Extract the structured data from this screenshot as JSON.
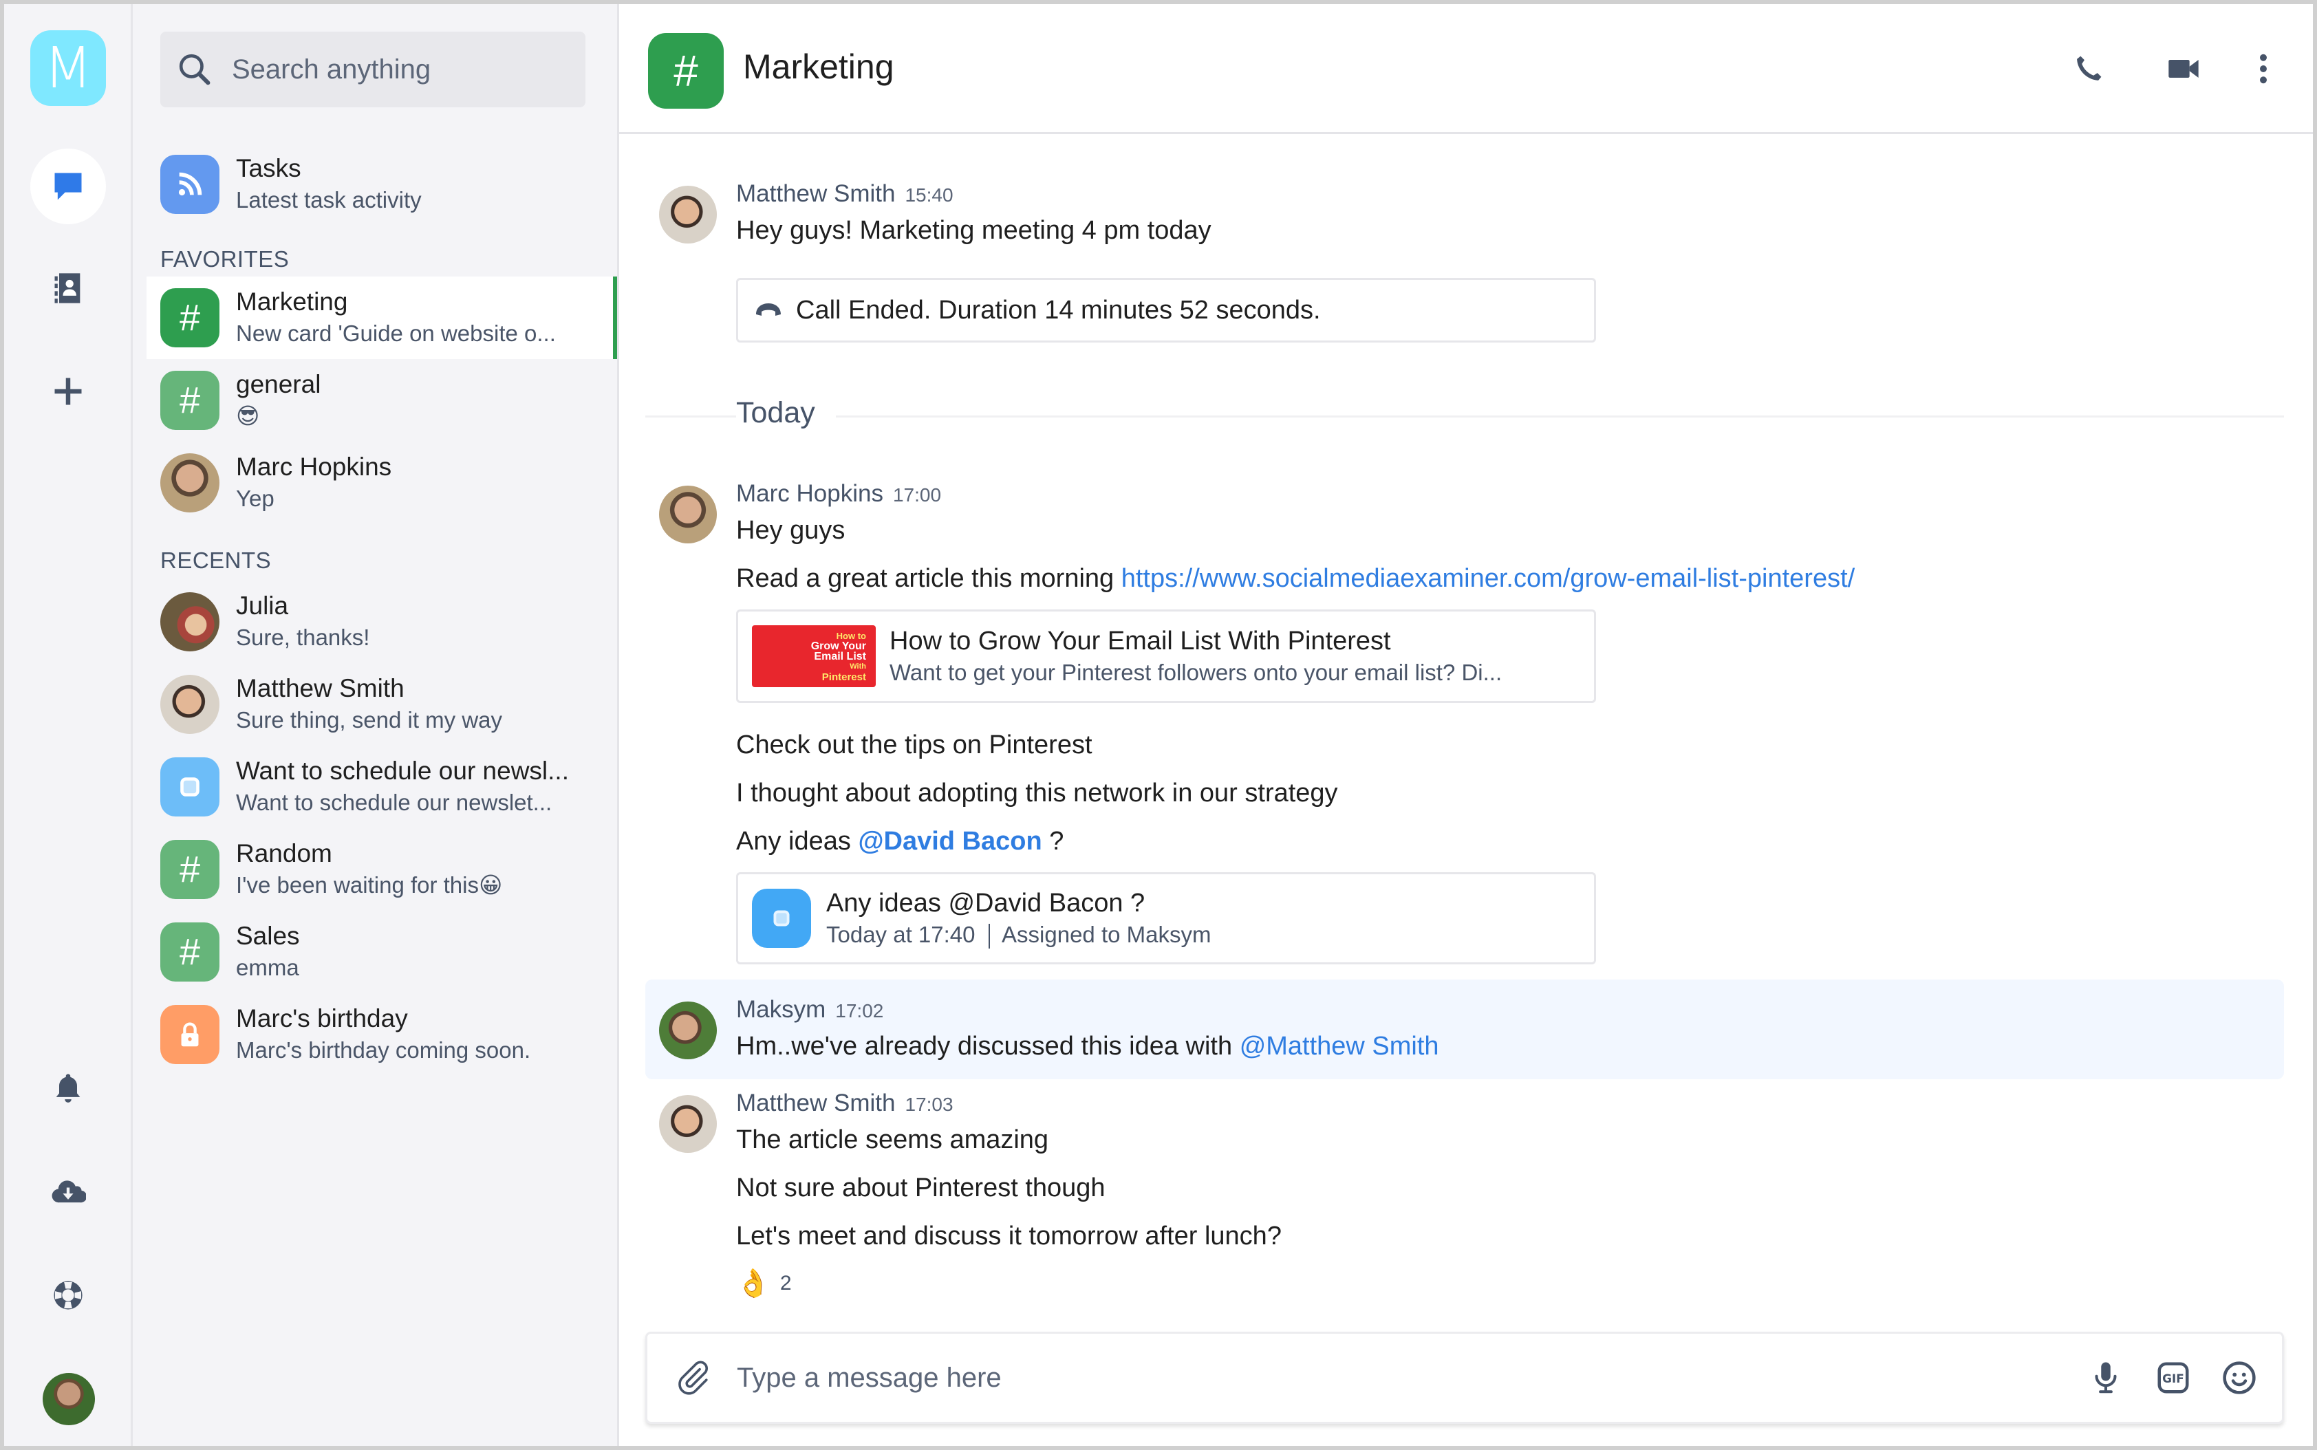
{
  "rail": {
    "logo_letter": "M",
    "items": [
      {
        "name": "chats",
        "icon": "chat-bubble-icon",
        "active": true
      },
      {
        "name": "contacts",
        "icon": "address-book-icon",
        "active": false
      },
      {
        "name": "add",
        "icon": "plus-icon",
        "active": false
      }
    ],
    "bottom_items": [
      {
        "name": "notifications",
        "icon": "bell-icon"
      },
      {
        "name": "download",
        "icon": "cloud-download-icon"
      },
      {
        "name": "help",
        "icon": "lifebuoy-icon"
      },
      {
        "name": "profile",
        "icon": "user-avatar"
      }
    ]
  },
  "sidebar": {
    "search_placeholder": "Search anything",
    "tasks": {
      "title": "Tasks",
      "subtitle": "Latest task activity",
      "icon": "rss-feed-icon"
    },
    "favorites_label": "FAVORITES",
    "favorites": [
      {
        "title": "Marketing",
        "subtitle": "New card 'Guide on website o...",
        "icon": "hash-icon",
        "selected": true
      },
      {
        "title": "general",
        "subtitle": "😎",
        "icon": "hash-icon",
        "selected": false
      },
      {
        "title": "Marc Hopkins",
        "subtitle": "Yep",
        "icon": "avatar",
        "selected": false
      }
    ],
    "recents_label": "RECENTS",
    "recents": [
      {
        "title": "Julia",
        "subtitle": "Sure, thanks!",
        "icon": "avatar"
      },
      {
        "title": "Matthew Smith",
        "subtitle": "Sure thing, send it my way",
        "icon": "avatar"
      },
      {
        "title": "Want to schedule our newsl...",
        "subtitle": "Want to schedule our newslet...",
        "icon": "task-icon"
      },
      {
        "title": "Random",
        "subtitle": "I've been waiting for this😀",
        "icon": "hash-icon"
      },
      {
        "title": "Sales",
        "subtitle": "emma",
        "icon": "hash-icon"
      },
      {
        "title": "Marc's birthday",
        "subtitle": "Marc's birthday coming soon.",
        "icon": "lock-icon"
      }
    ]
  },
  "header": {
    "title": "Marketing",
    "actions": [
      "phone-icon",
      "video-camera-icon",
      "more-vertical-icon"
    ]
  },
  "messages": {
    "m1": {
      "author": "Matthew Smith",
      "time": "15:40",
      "text": "Hey guys! Marketing meeting 4 pm today",
      "call_card": "Call Ended. Duration 14 minutes 52 seconds."
    },
    "divider_label": "Today",
    "m2": {
      "author": "Marc Hopkins",
      "time": "17:00",
      "line1": "Hey guys",
      "line2_prefix": "Read a great article this morning ",
      "line2_link": "https://www.socialmediaexaminer.com/grow-email-list-pinterest/",
      "preview_title": "How to Grow Your Email List With Pinterest",
      "preview_desc": "Want to get your Pinterest followers onto your email list? Di...",
      "preview_thumb_lines": [
        "How to",
        "Grow Your",
        "Email List",
        "With",
        "Pinterest"
      ],
      "line3": "Check out the tips on Pinterest",
      "line4": "I thought about adopting this network in our strategy",
      "line5_prefix": "Any ideas ",
      "line5_mention": "@David Bacon",
      "line5_suffix": " ?",
      "task_title": "Any ideas @David Bacon ?",
      "task_time": "Today at 17:40",
      "task_assigned": "Assigned to  Maksym"
    },
    "m3": {
      "author": "Maksym",
      "time": "17:02",
      "text_prefix": "Hm..we've already discussed this idea with ",
      "mention": "@Matthew Smith"
    },
    "m4": {
      "author": "Matthew Smith",
      "time": "17:03",
      "line1": "The article seems amazing",
      "line2": "Not sure about Pinterest though",
      "line3": "Let's meet and discuss it tomorrow after lunch?",
      "reaction_emoji": "👌",
      "reaction_count": "2"
    }
  },
  "composer": {
    "placeholder": "Type a message here",
    "icons": [
      "paperclip-icon",
      "microphone-icon",
      "gif-icon",
      "emoji-icon"
    ]
  },
  "colors": {
    "brand_logo": "#7fe8ff",
    "channel_green": "#2e9e4f",
    "channel_green_light": "#66b57a",
    "rss_blue": "#6399ef",
    "task_blue": "#6dbdf8",
    "lock_orange": "#ff9d66",
    "link_blue": "#2f7de1",
    "icon_slate": "#465368",
    "highlight_row": "#f2f7ff"
  }
}
